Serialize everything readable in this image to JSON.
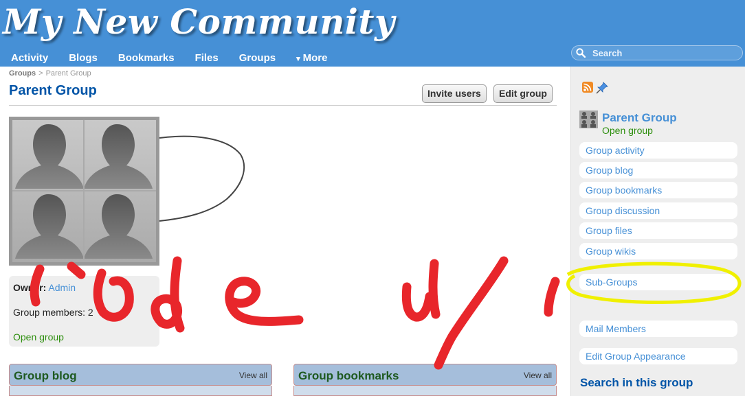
{
  "site": {
    "title": "My New Community"
  },
  "nav": {
    "items": [
      "Activity",
      "Blogs",
      "Bookmarks",
      "Files",
      "Groups"
    ],
    "more_caret": "▾",
    "more_label": "More"
  },
  "search": {
    "placeholder": "Search"
  },
  "breadcrumb": {
    "root": "Groups",
    "separator": ">",
    "current": "Parent Group"
  },
  "page": {
    "title": "Parent Group",
    "invite_label": "Invite users",
    "edit_label": "Edit group"
  },
  "owner_block": {
    "owner_label": "Owner:",
    "owner_name": "Admin",
    "members": "Group members: 2",
    "status": "Open group"
  },
  "widgets": [
    {
      "title": "Group blog",
      "view_all": "View all"
    },
    {
      "title": "Group bookmarks",
      "view_all": "View all"
    }
  ],
  "sidebar": {
    "icons": [
      "rss-icon",
      "pin-icon"
    ],
    "group_name": "Parent Group",
    "group_status": "Open group",
    "menu": [
      "Group activity",
      "Group blog",
      "Group bookmarks",
      "Group discussion",
      "Group files",
      "Group wikis",
      "Sub-Groups",
      "Mail Members",
      "Edit Group Appearance"
    ],
    "search_title": "Search in this group"
  },
  "colors": {
    "header": "#4690d6",
    "link": "#4690d6",
    "title": "#0054a7",
    "open_status": "#2c8e0c",
    "annotation_red": "#e8262b",
    "annotation_yellow": "#f0f000"
  }
}
